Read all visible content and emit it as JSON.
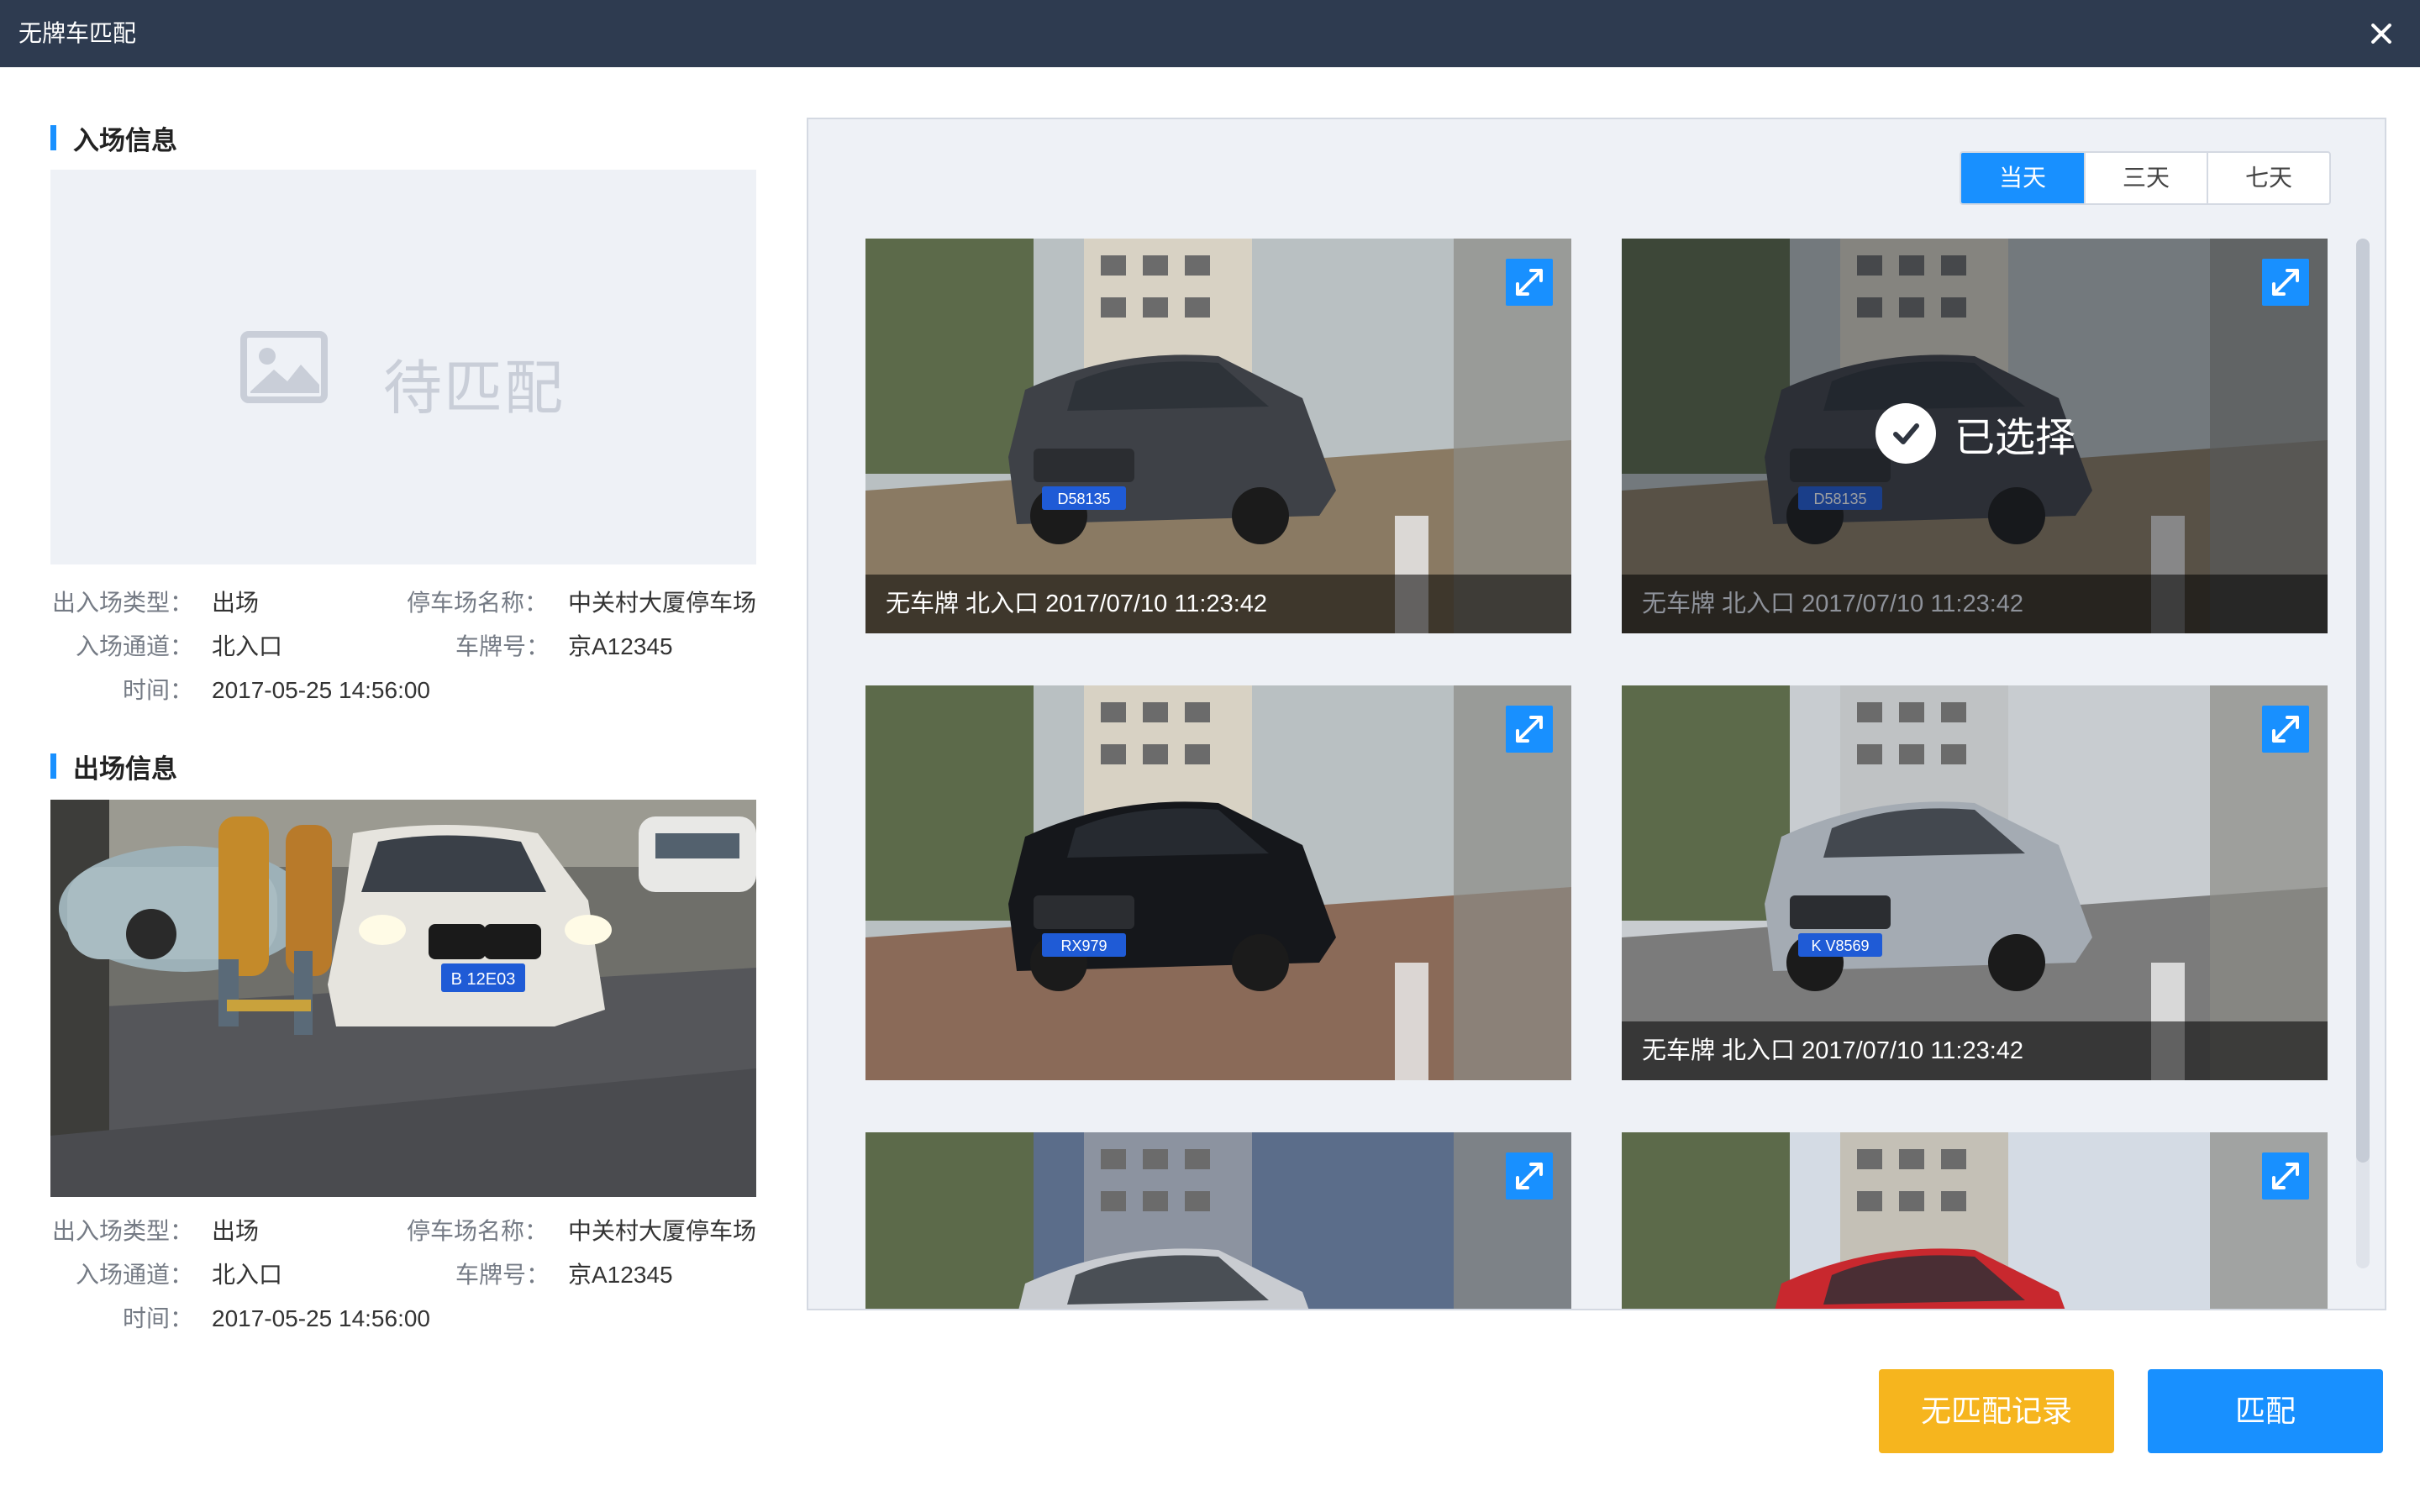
{
  "window": {
    "title": "无牌车匹配"
  },
  "entry": {
    "section_title": "入场信息",
    "placeholder_text": "待匹配",
    "fields": {
      "type_label": "出入场类型：",
      "type_value": "出场",
      "lot_label": "停车场名称：",
      "lot_value": "中关村大厦停车场",
      "channel_label": "入场通道：",
      "channel_value": "北入口",
      "plate_label": "车牌号：",
      "plate_value": "京A12345",
      "time_label": "时间：",
      "time_value": "2017-05-25 14:56:00"
    }
  },
  "exit": {
    "section_title": "出场信息",
    "photo_plate": "B 12E03",
    "fields": {
      "type_label": "出入场类型：",
      "type_value": "出场",
      "lot_label": "停车场名称：",
      "lot_value": "中关村大厦停车场",
      "channel_label": "入场通道：",
      "channel_value": "北入口",
      "plate_label": "车牌号：",
      "plate_value": "京A12345",
      "time_label": "时间：",
      "time_value": "2017-05-25 14:56:00"
    }
  },
  "gallery": {
    "tabs": [
      {
        "label": "当天",
        "active": true
      },
      {
        "label": "三天",
        "active": false
      },
      {
        "label": "七天",
        "active": false
      }
    ],
    "selected_label": "已选择",
    "cards": [
      {
        "caption": "无车牌 北入口 2017/07/10 11:23:42",
        "plate": "D58135",
        "selected": false
      },
      {
        "caption": "无车牌 北入口 2017/07/10 11:23:42",
        "plate": "D58135",
        "selected": true
      },
      {
        "caption": "",
        "plate": "RX979",
        "selected": false
      },
      {
        "caption": "无车牌 北入口 2017/07/10 11:23:42",
        "plate": "K V8569",
        "selected": false
      },
      {
        "caption": "",
        "plate": "",
        "selected": false
      },
      {
        "caption": "",
        "plate": "",
        "selected": false
      }
    ]
  },
  "footer": {
    "no_match_label": "无匹配记录",
    "match_label": "匹配"
  },
  "colors": {
    "titlebar": "#2e3b50",
    "primary": "#1890ff",
    "warning": "#f6b51e",
    "panel": "#eef1f6"
  }
}
